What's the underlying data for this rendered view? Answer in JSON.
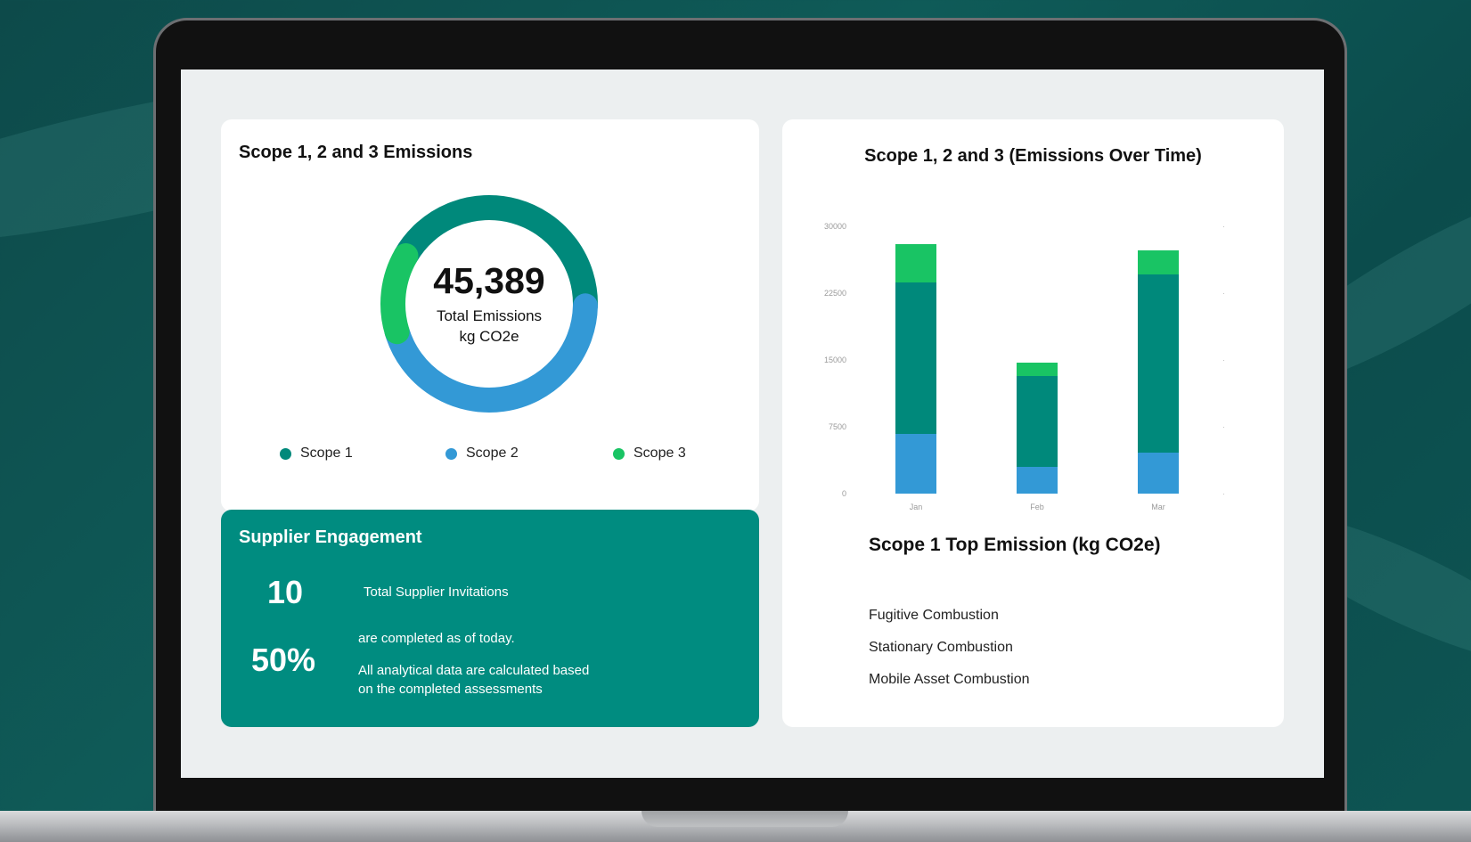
{
  "donut": {
    "title": "Scope 1, 2 and 3 Emissions",
    "total_value": "45,389",
    "total_label_line1": "Total Emissions",
    "total_label_line2": "kg CO2e",
    "legend": [
      {
        "label": "Scope 1",
        "color": "#00897b"
      },
      {
        "label": "Scope 2",
        "color": "#3399d6"
      },
      {
        "label": "Scope 3",
        "color": "#19c464"
      }
    ]
  },
  "supplier": {
    "title": "Supplier Engagement",
    "invitations_value": "10",
    "invitations_label": "Total Supplier Invitations",
    "completed_value": "50%",
    "completed_label": "are completed as of today.",
    "note_line1": "All analytical data are calculated based",
    "note_line2": "on the completed assessments"
  },
  "top_emission": {
    "title": "Scope 1 Top Emission (kg CO2e)",
    "items": [
      "Fugitive Combustion",
      "Stationary Combustion",
      "Mobile Asset Combustion"
    ]
  },
  "chart_data": [
    {
      "type": "pie",
      "title": "Scope 1, 2 and 3 Emissions",
      "categories": [
        "Scope 1",
        "Scope 2",
        "Scope 3"
      ],
      "values": [
        42,
        45,
        13
      ],
      "colors": [
        "#00897b",
        "#3399d6",
        "#19c464"
      ]
    },
    {
      "type": "bar",
      "stacked": true,
      "title": "Scope 1, 2 and 3 (Emissions Over Time)",
      "categories": [
        "Jan",
        "Feb",
        "Mar"
      ],
      "yticks": [
        "0",
        "7500",
        "15000",
        "22500",
        "30000"
      ],
      "ylim": [
        0,
        30000
      ],
      "series": [
        {
          "values": [
            6700,
            3000,
            4600
          ],
          "color": "#3399d6"
        },
        {
          "values": [
            17000,
            10200,
            20000
          ],
          "color": "#00897b"
        },
        {
          "values": [
            4300,
            1500,
            2700
          ],
          "color": "#19c464"
        }
      ],
      "grid": false
    }
  ]
}
